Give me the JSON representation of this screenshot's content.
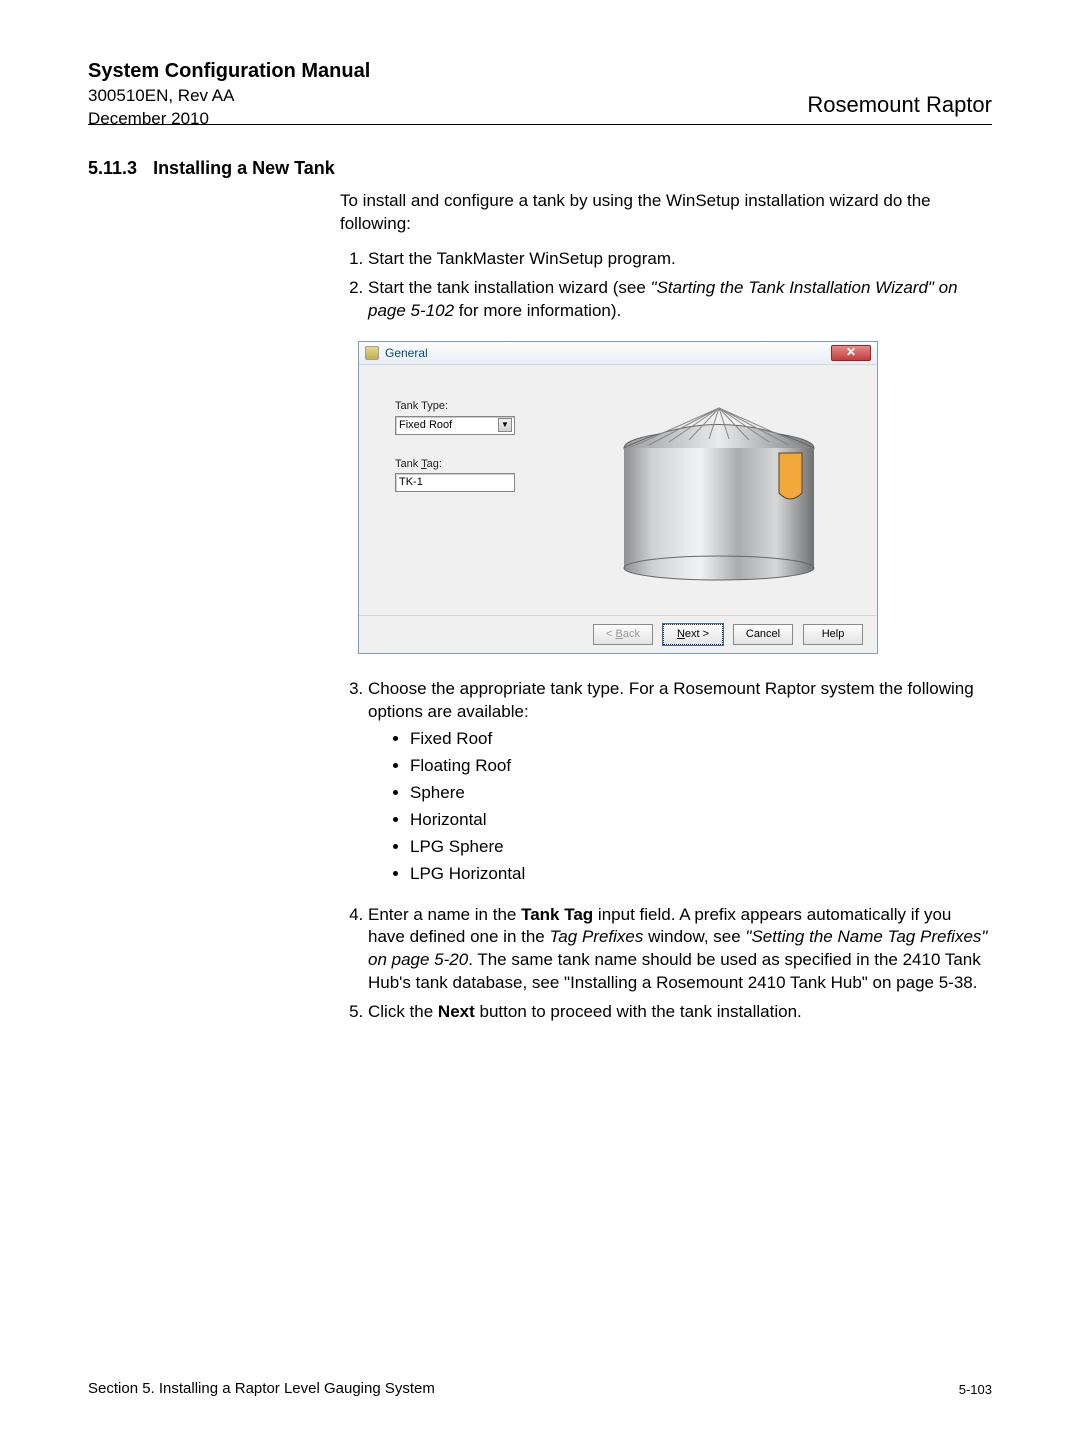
{
  "header": {
    "title": "System Configuration Manual",
    "doc_code": "300510EN, Rev AA",
    "date": "December 2010",
    "brand": "Rosemount Raptor"
  },
  "section": {
    "number": "5.11.3",
    "title": "Installing a New Tank"
  },
  "intro": "To install and configure a tank by using the WinSetup installation wizard do the following:",
  "step1": "Start the TankMaster WinSetup program.",
  "step2_a": "Start the tank installation wizard (see ",
  "step2_italic": "\"Starting the Tank Installation Wizard\" on page 5-102",
  "step2_b": " for more information).",
  "dialog": {
    "title": "General",
    "label_type": "Tank Type:",
    "select_value": "Fixed Roof",
    "label_tag_pre": "Tank ",
    "label_tag_u": "T",
    "label_tag_post": "ag:",
    "tag_value": "TK-1",
    "btn_back_u": "B",
    "btn_back_post": "ack",
    "btn_next_u": "N",
    "btn_next_post": "ext >",
    "btn_cancel": "Cancel",
    "btn_help": "Help"
  },
  "step3": "Choose the appropriate tank type. For a Rosemount Raptor system the following options are available:",
  "options": {
    "o1": "Fixed Roof",
    "o2": "Floating Roof",
    "o3": "Sphere",
    "o4": "Horizontal",
    "o5": "LPG Sphere",
    "o6": "LPG Horizontal"
  },
  "step4_a": "Enter a name in the ",
  "step4_bold1": "Tank Tag",
  "step4_b": " input field. A prefix appears automatically if you have defined one in the ",
  "step4_italic1": "Tag Prefixes",
  "step4_c": " window, see ",
  "step4_italic2": "\"Setting the Name Tag Prefixes\" on page 5-20",
  "step4_d": ". The same tank name should be used as specified in the 2410 Tank Hub's tank database, see \"Installing a Rosemount 2410 Tank Hub\" on page 5-38.",
  "step5_a": "Click the ",
  "step5_bold": "Next",
  "step5_b": " button to proceed with the tank installation.",
  "footer": {
    "left": "Section 5. Installing a Raptor Level Gauging System",
    "right": "5-103"
  }
}
